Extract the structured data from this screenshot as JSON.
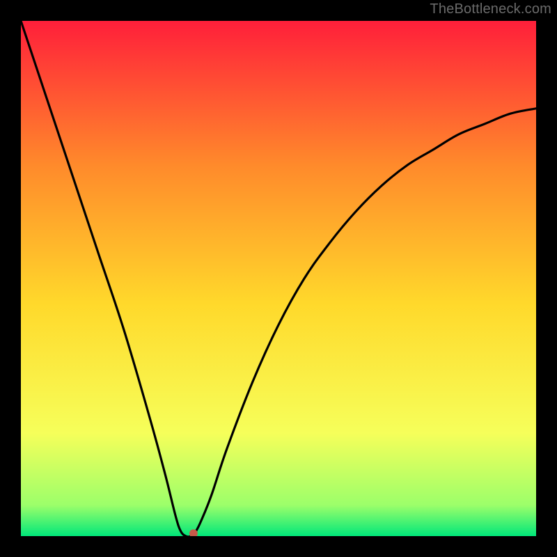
{
  "watermark": "TheBottleneck.com",
  "chart_data": {
    "type": "line",
    "title": "",
    "xlabel": "",
    "ylabel": "",
    "xlim": [
      0,
      100
    ],
    "ylim": [
      0,
      100
    ],
    "background_gradient": {
      "top": "#ff1f3a",
      "mid_upper": "#ff8a2b",
      "mid": "#ffd92b",
      "mid_lower": "#f6ff5a",
      "near_bottom": "#9cff6a",
      "bottom": "#00e77a"
    },
    "series": [
      {
        "name": "bottleneck-curve",
        "x": [
          0,
          5,
          10,
          15,
          20,
          25,
          28,
          30,
          31,
          32,
          33,
          34,
          35,
          37,
          40,
          45,
          50,
          55,
          60,
          65,
          70,
          75,
          80,
          85,
          90,
          95,
          100
        ],
        "y": [
          100,
          85,
          70,
          55,
          40,
          23,
          12,
          4,
          1,
          0,
          0,
          1,
          3,
          8,
          17,
          30,
          41,
          50,
          57,
          63,
          68,
          72,
          75,
          78,
          80,
          82,
          83
        ]
      }
    ],
    "marker": {
      "x": 33.5,
      "y": 0.5,
      "color": "#c65a4a",
      "radius_px": 6
    }
  }
}
